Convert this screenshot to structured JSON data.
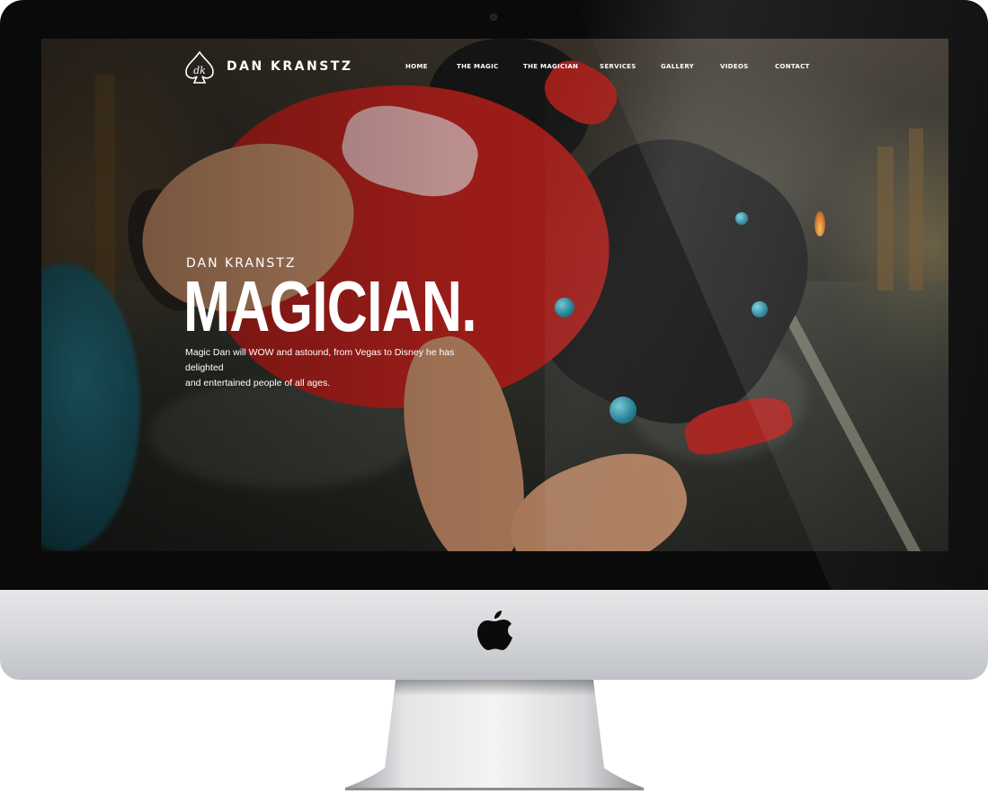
{
  "site": {
    "logo_monogram": "dk",
    "brand_name": "DAN KRANSTZ"
  },
  "nav": {
    "items": [
      {
        "label": "HOME"
      },
      {
        "label": "THE MAGIC"
      },
      {
        "label": "THE MAGICIAN"
      },
      {
        "label": "SERVICES"
      },
      {
        "label": "GALLERY"
      },
      {
        "label": "VIDEOS"
      },
      {
        "label": "CONTACT"
      }
    ]
  },
  "hero": {
    "eyebrow": "DAN KRANSTZ",
    "headline": "MAGICIAN.",
    "tagline_line1": "Magic Dan will WOW and astound, from Vegas to Disney he has delighted",
    "tagline_line2": "and entertained people of all ages."
  },
  "icons": {
    "logo": "spade-icon",
    "device_logo": "apple-icon"
  },
  "colors": {
    "accent_red": "#b3211c",
    "text": "#ffffff",
    "juggling_ball": "#1b8aa1"
  }
}
